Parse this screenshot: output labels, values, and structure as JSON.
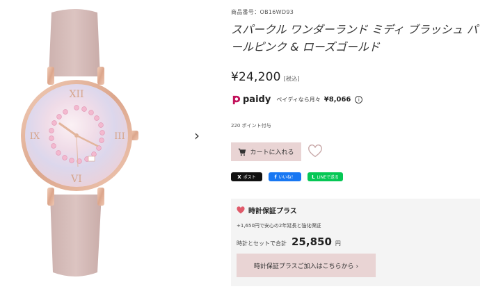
{
  "product": {
    "code_label": "商品番号：",
    "code": "OB16WD93",
    "title": "スパークル ワンダーランド ミディ ブラッシュ パールピンク & ローズゴールド",
    "price": "¥24,200",
    "tax_label": "[税込]",
    "points": "220 ポイント付与"
  },
  "paidy": {
    "logo_text": "paidy",
    "text": "ペイディなら月々",
    "amount": "¥8,066",
    "info_icon": "info-icon"
  },
  "gallery": {
    "next_arrow": "›",
    "watch_numerals": [
      "XII",
      "III",
      "VI",
      "IX"
    ]
  },
  "actions": {
    "cart_label": "カートに入れる",
    "cart_icon": "cart-icon",
    "favorite_icon": "heart-outline-icon"
  },
  "share": {
    "x_label": "ポスト",
    "x_glyph": "X",
    "fb_label": "いいね！",
    "fb_glyph": "f",
    "line_label": "LINEで送る",
    "line_glyph": "L"
  },
  "guarantee": {
    "title": "時計保証プラス",
    "description": "+1,650円で安心の2年延長と強化保証",
    "total_label": "時計とセットで合計",
    "total_amount": "25,850",
    "total_unit": "円",
    "button_label": "時計保証プラスご加入はこちらから ›"
  },
  "colors": {
    "button_pink": "#e9d4d4",
    "heart_red": "#e05a6a",
    "strap": "#d8bfbc",
    "rose_gold": "#e3b8a1"
  }
}
